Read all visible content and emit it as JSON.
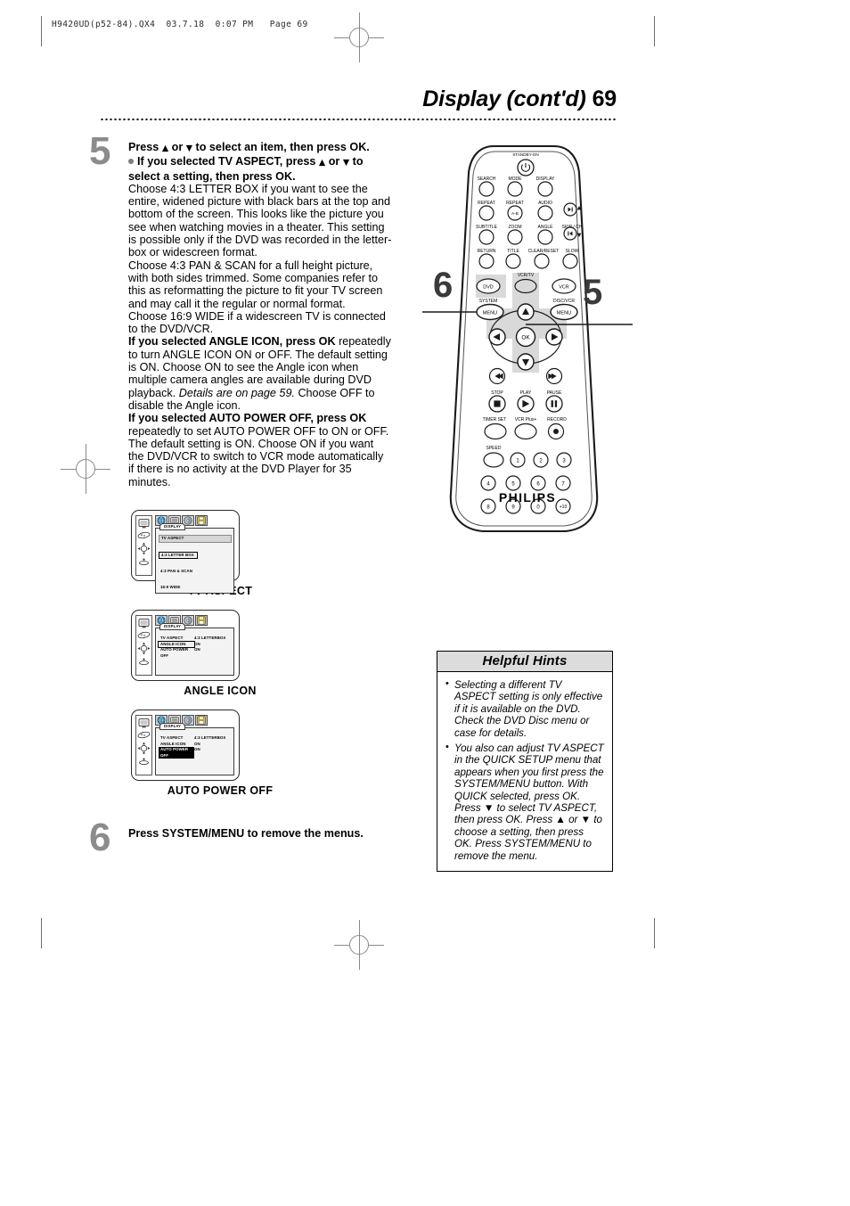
{
  "meta": {
    "filestamp": "H9420UD(p52-84).QX4  03.7.18  0:07 PM   Page 69"
  },
  "header": {
    "title": "Display (cont'd)",
    "page_number": "69"
  },
  "step5": {
    "number": "5",
    "line1_a": "Press",
    "line1_b": "or",
    "line1_c": "to select an item, then press OK.",
    "bullet1_a": "If you selected TV ASPECT, press",
    "bullet1_b": "or",
    "bullet1_c": "to",
    "bullet1_d": "select a setting, then press OK.",
    "para1": "Choose 4:3 LETTER BOX if you want to see the entire, widened picture with black bars at the top and bottom of the screen. This looks like the picture you see when watching movies in a theater.  This setting is possible only if the DVD was recorded in the letter-box or widescreen format.",
    "para2": "Choose 4:3 PAN & SCAN for a full height picture, with both sides trimmed. Some companies refer to this as reformatting the picture to fit your TV screen and may call it the regular or normal format.",
    "para3": "Choose 16:9 WIDE if a widescreen TV is connected to the DVD/VCR.",
    "bullet2_bold": "If you selected ANGLE ICON, press OK",
    "bullet2_rest_a": "repeatedly to turn ANGLE ICON ON or OFF. The default setting is ON. Choose ON to see the Angle icon when multiple camera angles are available during DVD playback.",
    "bullet2_italic": "Details are on page 59.",
    "bullet2_rest_b": "Choose OFF to disable the Angle icon.",
    "bullet3_bold": "If you selected AUTO POWER OFF, press OK",
    "bullet3_rest": "repeatedly to set AUTO POWER OFF to ON or OFF. The default setting is ON. Choose ON if you want the DVD/VCR to switch to VCR mode automatically if there is no activity at the DVD Player for 35 minutes."
  },
  "step6": {
    "number": "6",
    "text": "Press SYSTEM/MENU to remove the menus."
  },
  "figures": [
    {
      "caption": "TV ASPECT",
      "tab_name": "DISPLAY",
      "header": "TV ASPECT",
      "options": [
        {
          "label": "4:3 LETTER BOX",
          "selected": true
        },
        {
          "label": "4:3 PAN & SCAN",
          "selected": false
        },
        {
          "label": "16:9 WIDE",
          "selected": false
        }
      ],
      "rows": []
    },
    {
      "caption": "ANGLE ICON",
      "tab_name": "DISPLAY",
      "header": "",
      "options": [],
      "rows": [
        {
          "label": "TV ASPECT",
          "value": "4:3 LETTERBOX",
          "highlight": "none"
        },
        {
          "label": "ANGLE ICON",
          "value": "ON",
          "highlight": "box"
        },
        {
          "label": "AUTO POWER OFF",
          "value": "ON",
          "highlight": "none"
        }
      ]
    },
    {
      "caption": "AUTO POWER OFF",
      "tab_name": "DISPLAY",
      "header": "",
      "options": [],
      "rows": [
        {
          "label": "TV ASPECT",
          "value": "4:3 LETTERBOX",
          "highlight": "none"
        },
        {
          "label": "ANGLE ICON",
          "value": "ON",
          "highlight": "none"
        },
        {
          "label": "AUTO POWER OFF",
          "value": "ON",
          "highlight": "fill"
        }
      ]
    }
  ],
  "remote": {
    "callout_left": "6",
    "callout_right": "5",
    "brand": "PHILIPS",
    "labels": {
      "standby": "STANDBY-ON",
      "search": "SEARCH",
      "mode": "MODE",
      "display": "DISPLAY",
      "repeat1": "REPEAT",
      "repeat2": "REPEAT",
      "audio": "AUDIO",
      "ab": "A-B",
      "subtitle": "SUBTITLE",
      "zoom": "ZOOM",
      "angle": "ANGLE",
      "skip_ch": "SKIP / CH",
      "return": "RETURN",
      "title": "TITLE",
      "clear_reset": "CLEAR/RESET",
      "slow": "SLOW",
      "vcr_tv": "VCR/TV",
      "dvd": "DVD",
      "vcr": "VCR",
      "system": "SYSTEM",
      "disc_vcr": "DISC/VCR",
      "menu_left": "MENU",
      "menu_right": "MENU",
      "ok": "OK",
      "stop": "STOP",
      "play": "PLAY",
      "pause": "PAUSE",
      "timer_set": "TIMER SET",
      "vcr_plus": "VCR Plus+",
      "record": "RECORD",
      "speed": "SPEED"
    },
    "keypad": [
      "1",
      "2",
      "3",
      "4",
      "5",
      "6",
      "7",
      "8",
      "9",
      "0",
      "+10"
    ]
  },
  "hints": {
    "title": "Helpful Hints",
    "items": [
      "Selecting a different TV ASPECT setting is only effective if it is available on the DVD. Check the DVD Disc menu or case for details.",
      "You also can adjust TV ASPECT in the QUICK SETUP menu that appears when you first press the SYSTEM/MENU button. With QUICK selected, press OK. Press ▼ to select TV ASPECT, then press OK. Press ▲ or ▼ to choose a setting, then press OK. Press SYSTEM/MENU to remove the menu."
    ]
  },
  "colors": {
    "step_number": "#8c8c8c",
    "hints_title_bg": "#dcdcdc",
    "osd_highlight": "#000000",
    "tab_globe": "#2e7fc1",
    "tab_save": "#e8c840"
  }
}
